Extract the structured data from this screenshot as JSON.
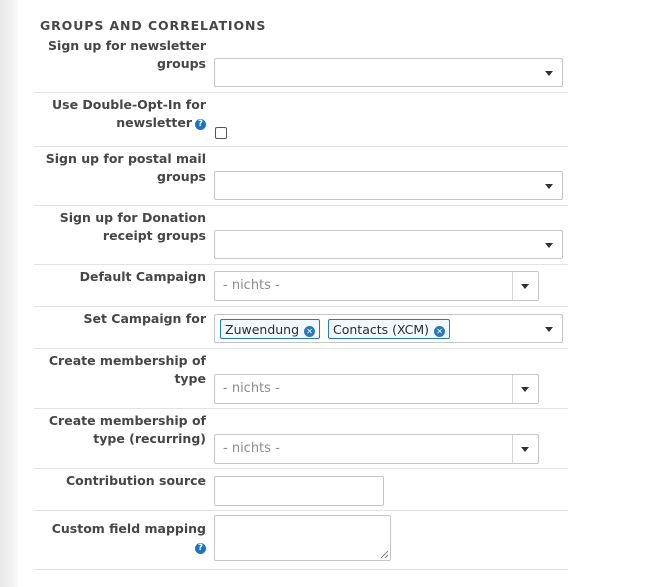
{
  "section": {
    "title": "GROUPS AND CORRELATIONS"
  },
  "fields": {
    "newsletter_groups": {
      "label_line1": "Sign up for newsletter",
      "label_line2": "groups"
    },
    "double_opt_in": {
      "label_line1": "Use Double-Opt-In for",
      "label_line2": "newsletter",
      "checked": false
    },
    "postal_mail_groups": {
      "label_line1": "Sign up for postal mail",
      "label_line2": "groups"
    },
    "donation_receipt_groups": {
      "label_line1": "Sign up for Donation",
      "label_line2": "receipt groups"
    },
    "default_campaign": {
      "label": "Default Campaign",
      "placeholder": "- nichts -"
    },
    "set_campaign_for": {
      "label": "Set Campaign for",
      "chips": [
        "Zuwendung",
        "Contacts (XCM)"
      ]
    },
    "membership_type": {
      "label_line1": "Create membership of",
      "label_line2": "type",
      "placeholder": "- nichts -"
    },
    "membership_type_recurring": {
      "label_line1": "Create membership of",
      "label_line2": "type (recurring)",
      "placeholder": "- nichts -"
    },
    "contribution_source": {
      "label": "Contribution source",
      "value": ""
    },
    "custom_field_mapping": {
      "label": "Custom field mapping",
      "value": ""
    }
  },
  "icons": {
    "help": "question-circle-icon",
    "remove": "times-circle-icon",
    "dropdown": "caret-down-icon"
  },
  "colors": {
    "accent": "#2b79b6",
    "help_icon": "#1f75bd",
    "border": "#c5c5c5"
  }
}
